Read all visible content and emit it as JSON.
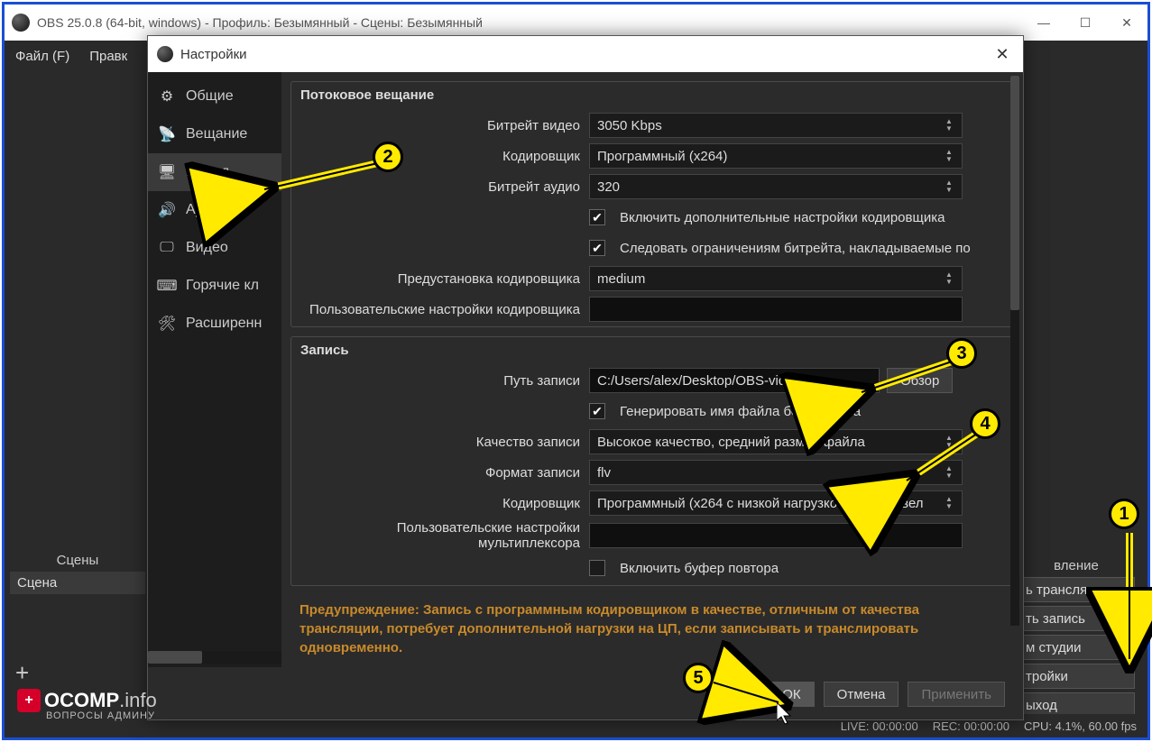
{
  "window": {
    "title": "OBS 25.0.8 (64-bit, windows) - Профиль: Безымянный - Сцены: Безымянный"
  },
  "menu": {
    "file": "Файл (F)",
    "edit": "Правк"
  },
  "scenes": {
    "header": "Сцены",
    "item": "Сцена"
  },
  "right": {
    "manage": "вление",
    "start_stream": "ь трансляцию",
    "start_rec": "ть запись",
    "studio": "м студии",
    "settings": "тройки",
    "exit": "ыход"
  },
  "status": {
    "live": "LIVE: 00:00:00",
    "rec": "REC: 00:00:00",
    "cpu": "CPU: 4.1%, 60.00 fps"
  },
  "dialog": {
    "title": "Настройки",
    "sidebar": {
      "general": "Общие",
      "stream": "Вещание",
      "output": "Вывод",
      "audio": "Аудио",
      "video": "Видео",
      "hotkeys": "Горячие кл",
      "advanced": "Расширенн"
    }
  },
  "streaming": {
    "header": "Потоковое вещание",
    "video_bitrate_lbl": "Битрейт видео",
    "video_bitrate_val": "3050 Kbps",
    "encoder_lbl": "Кодировщик",
    "encoder_val": "Программный (x264)",
    "audio_bitrate_lbl": "Битрейт аудио",
    "audio_bitrate_val": "320",
    "chk_advanced": "Включить дополнительные настройки кодировщика",
    "chk_enforce": "Следовать ограничениям битрейта, накладываемые по",
    "preset_lbl": "Предустановка кодировщика",
    "preset_val": "medium",
    "custom_lbl": "Пользовательские настройки кодировщика"
  },
  "recording": {
    "header": "Запись",
    "path_lbl": "Путь записи",
    "path_val": "C:/Users/alex/Desktop/OBS-video",
    "browse": "Обзор",
    "chk_nospace": "Генерировать имя файла без пробела",
    "quality_lbl": "Качество записи",
    "quality_val": "Высокое качество, средний размер файла",
    "format_lbl": "Формат записи",
    "format_val": "flv",
    "encoder_lbl": "Кодировщик",
    "encoder_val": "Программный (x264 с низкой нагрузкой на ЦП, увел",
    "mux_lbl": "Пользовательские настройки мультиплексора",
    "chk_replay": "Включить буфер повтора"
  },
  "warning": "Предупреждение: Запись с программным кодировщиком в качестве, отличным от качества трансляции, потребует дополнительной нагрузки на ЦП, если записывать и транслировать одновременно.",
  "footer": {
    "ok": "ОК",
    "cancel": "Отмена",
    "apply": "Применить"
  },
  "logo": {
    "name": "OCOMP",
    "suffix": ".info",
    "sub": "ВОПРОСЫ АДМИНУ"
  },
  "annotations": [
    "1",
    "2",
    "3",
    "4",
    "5"
  ]
}
